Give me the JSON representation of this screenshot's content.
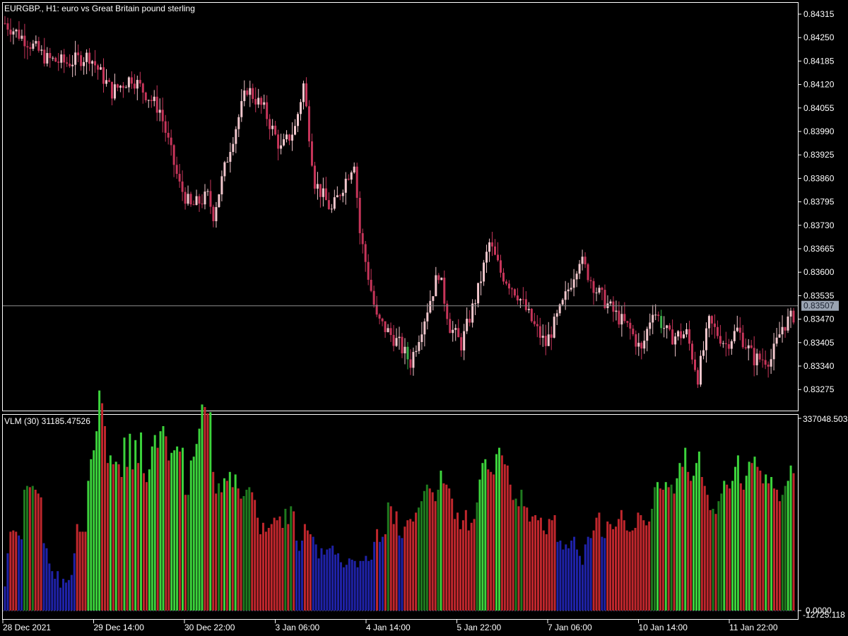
{
  "colors": {
    "background": "#000000",
    "frame": "#ffffff",
    "candle_bull": "#f2c7cd",
    "candle_bear": "#c7355a",
    "candle_special": "#3ab24a",
    "current_line": "#8e8e8e",
    "current_box": "#9aa4b2",
    "vol_bear": "#c0272d",
    "vol_bull": "#3cd33c",
    "vol_dark_bull": "#1f7a1f",
    "vol_low": "#1f22a8"
  },
  "main_panel": {
    "title": "EURGBP., H1:  euro vs Great Britain pound sterling",
    "current_price": "0.83507"
  },
  "volume_panel": {
    "title": "VLM (30) 31185.47526",
    "top_label": "337048.503",
    "zero_label": "0.0000",
    "bottom_label": "-12725.118"
  },
  "chart_data": [
    {
      "type": "candlestick",
      "symbol": "EURGBP.",
      "timeframe": "H1",
      "description": "euro vs Great Britain pound sterling",
      "y_axis_ticks": [
        "0.84315",
        "0.84250",
        "0.84185",
        "0.84120",
        "0.84055",
        "0.83990",
        "0.83925",
        "0.83860",
        "0.83795",
        "0.83730",
        "0.83665",
        "0.83600",
        "0.83535",
        "0.83470",
        "0.83405",
        "0.83340",
        "0.83275"
      ],
      "ylim": [
        0.8321,
        0.8435
      ],
      "x_axis_ticks": [
        "28 Dec 2021",
        "29 Dec 14:00",
        "30 Dec 22:00",
        "3 Jan 06:00",
        "4 Jan 14:00",
        "5 Jan 22:00",
        "7 Jan 06:00",
        "10 Jan 14:00",
        "11 Jan 22:00"
      ],
      "path_anchors": [
        [
          0,
          0.8429
        ],
        [
          8,
          0.8424
        ],
        [
          15,
          0.8419
        ],
        [
          22,
          0.8418
        ],
        [
          30,
          0.842
        ],
        [
          38,
          0.841
        ],
        [
          45,
          0.8414
        ],
        [
          55,
          0.8405
        ],
        [
          62,
          0.8384
        ],
        [
          66,
          0.8378
        ],
        [
          72,
          0.8381
        ],
        [
          74,
          0.8376
        ],
        [
          80,
          0.8395
        ],
        [
          86,
          0.8411
        ],
        [
          92,
          0.8405
        ],
        [
          98,
          0.8394
        ],
        [
          103,
          0.84
        ],
        [
          106,
          0.8412
        ],
        [
          110,
          0.8385
        ],
        [
          116,
          0.8377
        ],
        [
          120,
          0.8384
        ],
        [
          124,
          0.8391
        ],
        [
          126,
          0.8371
        ],
        [
          132,
          0.8347
        ],
        [
          140,
          0.834
        ],
        [
          144,
          0.8335
        ],
        [
          150,
          0.835
        ],
        [
          154,
          0.836
        ],
        [
          158,
          0.8345
        ],
        [
          162,
          0.834
        ],
        [
          168,
          0.8355
        ],
        [
          172,
          0.8368
        ],
        [
          176,
          0.836
        ],
        [
          182,
          0.8354
        ],
        [
          188,
          0.8345
        ],
        [
          192,
          0.834
        ],
        [
          198,
          0.8351
        ],
        [
          204,
          0.8364
        ],
        [
          210,
          0.8355
        ],
        [
          216,
          0.8349
        ],
        [
          222,
          0.8344
        ],
        [
          226,
          0.8338
        ],
        [
          230,
          0.835
        ],
        [
          236,
          0.8342
        ],
        [
          242,
          0.8343
        ],
        [
          246,
          0.8331
        ],
        [
          250,
          0.8346
        ],
        [
          256,
          0.834
        ],
        [
          260,
          0.8344
        ],
        [
          266,
          0.8336
        ],
        [
          272,
          0.8336
        ],
        [
          276,
          0.8345
        ],
        [
          280,
          0.8348
        ]
      ],
      "current_price": 0.83507
    },
    {
      "type": "bar",
      "indicator": "VLM",
      "period": 30,
      "value": 31185.47526,
      "ylim": [
        -12725.118,
        337048.503
      ],
      "categories_note": "hourly bars, colored by volume regime",
      "values": [
        19,
        45,
        62,
        63,
        62,
        59,
        56,
        95,
        98,
        97,
        98,
        95,
        92,
        89,
        53,
        49,
        37,
        31,
        25,
        31,
        18,
        25,
        22,
        24,
        28,
        45,
        68,
        62,
        62,
        62,
        102,
        119,
        126,
        141,
        173,
        163,
        145,
        116,
        122,
        115,
        117,
        115,
        105,
        136,
        113,
        139,
        111,
        134,
        116,
        140,
        108,
        101,
        111,
        129,
        138,
        128,
        141,
        145,
        137,
        118,
        124,
        126,
        129,
        125,
        128,
        91,
        91,
        118,
        121,
        131,
        143,
        162,
        160,
        155,
        156,
        109,
        92,
        100,
        93,
        104,
        102,
        109,
        97,
        107,
        96,
        88,
        90,
        95,
        97,
        93,
        87,
        73,
        60,
        69,
        62,
        65,
        68,
        73,
        71,
        74,
        65,
        80,
        68,
        82,
        78,
        55,
        47,
        55,
        68,
        63,
        60,
        58,
        52,
        41,
        49,
        44,
        48,
        49,
        51,
        44,
        45,
        38,
        34,
        36,
        41,
        40,
        39,
        34,
        39,
        39,
        43,
        39,
        40,
        54,
        64,
        54,
        58,
        60,
        85,
        82,
        68,
        78,
        59,
        57,
        66,
        71,
        72,
        70,
        77,
        81,
        86,
        94,
        99,
        96,
        93,
        86,
        95,
        110,
        100,
        99,
        96,
        88,
        72,
        77,
        64,
        71,
        79,
        63,
        69,
        72,
        85,
        103,
        116,
        119,
        111,
        109,
        107,
        123,
        128,
        122,
        115,
        114,
        99,
        87,
        88,
        82,
        95,
        82,
        81,
        70,
        74,
        75,
        71,
        73,
        63,
        60,
        72,
        71,
        75,
        54,
        55,
        48,
        52,
        49,
        55,
        58,
        48,
        43,
        36,
        52,
        58,
        57,
        63,
        73,
        77,
        58,
        57,
        70,
        68,
        64,
        66,
        72,
        79,
        71,
        63,
        62,
        63,
        65,
        77,
        75,
        71,
        67,
        70,
        80,
        97,
        101,
        96,
        95,
        101,
        97,
        99,
        92,
        104,
        116,
        113,
        128,
        109,
        102,
        106,
        116,
        125,
        105,
        98,
        91,
        79,
        80,
        76,
        86,
        92,
        102,
        99,
        96,
        102,
        113,
        122,
        100,
        95,
        106,
        117,
        116,
        121,
        113,
        110,
        100,
        107,
        100,
        105,
        96,
        95,
        86,
        91,
        98,
        102,
        114,
        108
      ],
      "colors_note": "red = falling volume, green = rising volume, blue = low volume"
    }
  ]
}
